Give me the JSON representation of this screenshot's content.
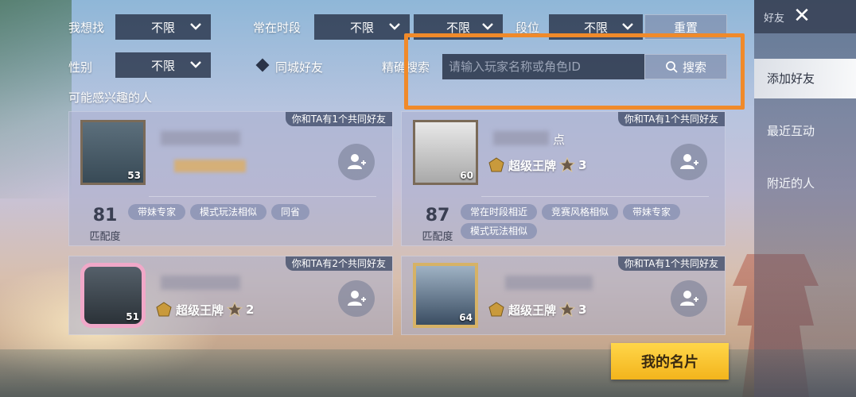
{
  "filters": {
    "looking_for_label": "我想找",
    "looking_for_value": "不限",
    "active_time_label": "常在时段",
    "active_time_value_1": "不限",
    "active_time_value_2": "不限",
    "rank_label": "段位",
    "rank_value": "不限",
    "reset_label": "重置",
    "gender_label": "性别",
    "gender_value": "不限",
    "same_city_label": "同城好友",
    "precise_search_label": "精确搜索",
    "search_placeholder": "请输入玩家名称或角色ID",
    "search_button_label": "搜索"
  },
  "section_title": "可能感兴趣的人",
  "cards": [
    {
      "mutual_text": "你和TA有1个共同好友",
      "level": "53",
      "score": "81",
      "score_label": "匹配度",
      "tags": [
        "带妹专家",
        "模式玩法相似",
        "同省"
      ]
    },
    {
      "mutual_text": "你和TA有1个共同好友",
      "level": "60",
      "name_suffix": "点",
      "rank_name": "超级王牌",
      "rank_stars": "3",
      "score": "87",
      "score_label": "匹配度",
      "tags": [
        "常在时段相近",
        "竞赛风格相似",
        "带妹专家",
        "模式玩法相似"
      ]
    },
    {
      "mutual_text": "你和TA有2个共同好友",
      "level": "51",
      "rank_name": "超级王牌",
      "rank_stars": "2"
    },
    {
      "mutual_text": "你和TA有1个共同好友",
      "level": "64",
      "rank_name": "超级王牌",
      "rank_stars": "3"
    }
  ],
  "my_card_label": "我的名片",
  "side_panel": {
    "title": "好友",
    "items": [
      "添加好友",
      "最近互动",
      "附近的人"
    ],
    "active_index": 0
  },
  "colors": {
    "highlight_border": "#f08a2a",
    "primary_button": "#f3b41c"
  }
}
